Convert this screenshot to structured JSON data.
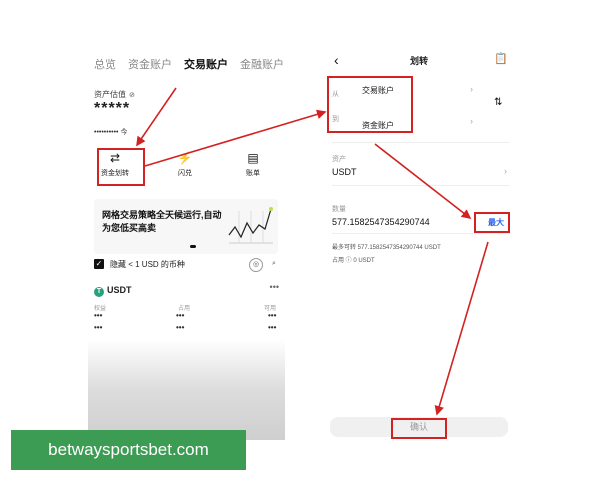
{
  "left": {
    "tabs": [
      "总览",
      "资金账户",
      "交易账户",
      "金融账户"
    ],
    "active_tab_index": 2,
    "asset_valuation_label": "资产估值",
    "balance_masked": "*****",
    "sub_balance_masked": "•••••••••• 今",
    "quick_actions": [
      {
        "label": "资金划转",
        "icon": "transfer-icon"
      },
      {
        "label": "闪兑",
        "icon": "flash-swap-icon"
      },
      {
        "label": "账单",
        "icon": "bill-icon"
      }
    ],
    "banner_text": "网格交易策略全天候运行,自动为您低买高卖",
    "hide_small_label": "隐藏 < 1 USD 的币种",
    "coin": {
      "symbol": "USDT",
      "columns": [
        "权益",
        "占用",
        "可用"
      ],
      "values": [
        "•••",
        "•••",
        "•••"
      ],
      "values_row2": [
        "•••",
        "•••",
        "•••"
      ]
    }
  },
  "right": {
    "title": "划转",
    "from_label": "从",
    "from_account": "交易账户",
    "to_label": "到",
    "to_account": "资金账户",
    "asset_label": "资产",
    "asset_value": "USDT",
    "amount_label": "数量",
    "amount_value": "577.1582547354290744",
    "max_label": "最大",
    "max_transferable": "最多可转 577.1582547354290744 USDT",
    "occupied": "占用 ⓘ 0 USDT",
    "confirm_label": "确认"
  },
  "watermark": "betwaysportsbet.com",
  "colors": {
    "highlight": "#d32222",
    "link_blue": "#2563eb",
    "watermark_green": "#3d9c54"
  }
}
